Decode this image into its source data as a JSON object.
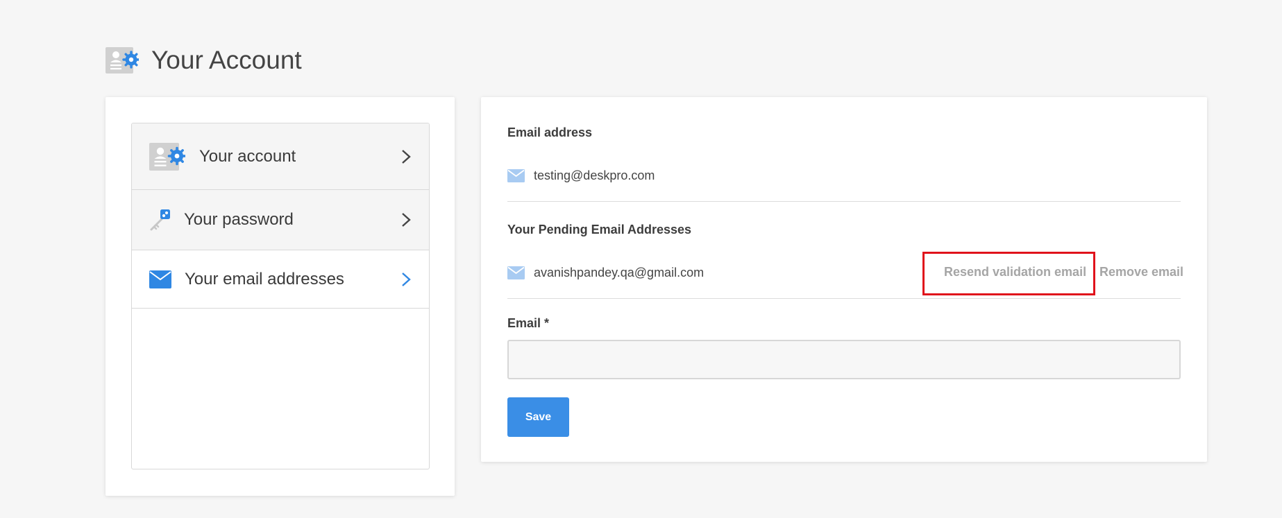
{
  "page": {
    "title": "Your Account",
    "header_icon": "account-settings-icon"
  },
  "sidebar": {
    "items": [
      {
        "label": "Your account",
        "icon": "account-settings-icon",
        "active": false
      },
      {
        "label": "Your password",
        "icon": "key-icon",
        "active": false
      },
      {
        "label": "Your email addresses",
        "icon": "envelope-icon",
        "active": true
      }
    ]
  },
  "main": {
    "email_section": {
      "label": "Email address",
      "primary_email": "testing@deskpro.com"
    },
    "pending_section": {
      "label": "Your Pending Email Addresses",
      "pending_email": "avanishpandey.qa@gmail.com",
      "resend_label": "Resend validation email",
      "remove_label": "Remove email"
    },
    "form": {
      "email_label": "Email *",
      "email_value": "",
      "email_placeholder": "",
      "save_label": "Save"
    }
  },
  "colors": {
    "accent": "#3a8ee6",
    "highlight": "#e0121b",
    "background": "#f6f6f6",
    "link_gray": "#a5a5a5"
  }
}
